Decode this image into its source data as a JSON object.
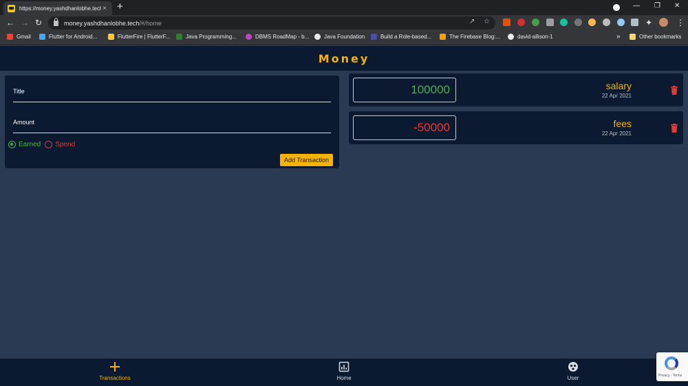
{
  "browser": {
    "tab_title": "https://money.yashdhanlobhe.tech/",
    "tab_close": "×",
    "new_tab": "+",
    "url_host": "money.yashdhanlobhe.tech",
    "url_path": "/#/home",
    "bookmarks": [
      {
        "label": "Gmail",
        "color": "#ea4335"
      },
      {
        "label": "Flutter for Android...",
        "color": "#42a5f5"
      },
      {
        "label": "FlutterFire | FlutterF...",
        "color": "#ffca28"
      },
      {
        "label": "Java Programming...",
        "color": "#2e7d32"
      },
      {
        "label": "DBMS RoadMap - b...",
        "color": "#c542c5"
      },
      {
        "label": "Java Foundation",
        "color": "#e8eaed"
      },
      {
        "label": "Build a Role-based...",
        "color": "#3f51b5"
      },
      {
        "label": "The Firebase Blog:...",
        "color": "#ffa000"
      },
      {
        "label": "david-allison-1",
        "color": "#e8eaed"
      }
    ],
    "more_bookmarks": "»",
    "other_bookmarks": "Other bookmarks"
  },
  "app": {
    "title": "Money",
    "colors": {
      "accent": "#f5b30a",
      "earned": "#4caf50",
      "spend": "#e53935",
      "surface": "#0b1a30",
      "background": "#2a3a52"
    }
  },
  "form": {
    "title_label": "Title",
    "amount_label": "Amount",
    "radio_earned": "Earned",
    "radio_spend": "Spend",
    "selected": "Earned",
    "submit": "Add Transaction"
  },
  "transactions": [
    {
      "amount": "100000",
      "title": "salary",
      "date": "22 Apr 2021",
      "type": "earned"
    },
    {
      "amount": "-50000",
      "title": "fees",
      "date": "22 Apr 2021",
      "type": "spend"
    }
  ],
  "bottom_nav": [
    {
      "label": "Transactions",
      "icon": "plus-icon",
      "active": true
    },
    {
      "label": "Home",
      "icon": "bar-chart-icon",
      "active": false
    },
    {
      "label": "User",
      "icon": "user-face-icon",
      "active": false
    }
  ],
  "recaptcha": {
    "text": "Privacy - Terms"
  }
}
